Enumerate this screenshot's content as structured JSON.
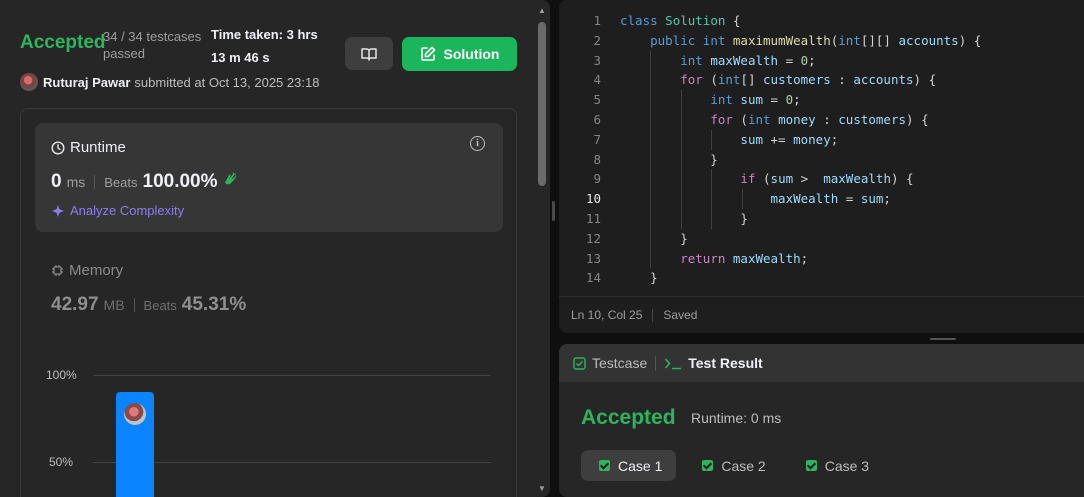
{
  "submission": {
    "status": "Accepted",
    "testcases_line1": "34 / 34 testcases",
    "testcases_line2": "passed",
    "time_taken_line1": "Time taken: 3 hrs",
    "time_taken_line2": "13 m 46 s",
    "solution_label": "Solution",
    "submitter_name": "Ruturaj Pawar",
    "submitted_at": "submitted at Oct 13, 2025 23:18"
  },
  "runtime": {
    "title": "Runtime",
    "value": "0",
    "unit": "ms",
    "beats_label": "Beats",
    "beats_pct": "100.00%",
    "analyze_label": "Analyze Complexity"
  },
  "memory": {
    "title": "Memory",
    "value": "42.97",
    "unit": "MB",
    "beats_label": "Beats",
    "beats_pct": "45.31%"
  },
  "distribution": {
    "tick_100": "100%",
    "tick_50": "50%",
    "bar_percent": 90
  },
  "editor": {
    "lines": [
      {
        "num": "1",
        "code": "class Solution {"
      },
      {
        "num": "2",
        "code": "    public int maximumWealth(int[][] accounts) {"
      },
      {
        "num": "3",
        "code": "        int maxWealth = 0;"
      },
      {
        "num": "4",
        "code": "        for (int[] customers : accounts) {"
      },
      {
        "num": "5",
        "code": "            int sum = 0;"
      },
      {
        "num": "6",
        "code": "            for (int money : customers) {"
      },
      {
        "num": "7",
        "code": "                sum += money;"
      },
      {
        "num": "8",
        "code": "            }"
      },
      {
        "num": "9",
        "code": "                if (sum >  maxWealth) {"
      },
      {
        "num": "10",
        "code": "                    maxWealth = sum;"
      },
      {
        "num": "11",
        "code": "                }"
      },
      {
        "num": "12",
        "code": "        }"
      },
      {
        "num": "13",
        "code": "        return maxWealth;"
      },
      {
        "num": "14",
        "code": "    }"
      }
    ],
    "cursor_position": "Ln 10, Col 25",
    "save_state": "Saved"
  },
  "result": {
    "tab_testcase": "Testcase",
    "tab_test_result": "Test Result",
    "status": "Accepted",
    "runtime": "Runtime: 0 ms",
    "cases": [
      "Case 1",
      "Case 2",
      "Case 3"
    ]
  },
  "colors": {
    "accepted_green": "#2db55d",
    "solution_button": "#1bb55c",
    "bar_blue": "#0a84ff",
    "analyze_purple": "#8b7ff0"
  }
}
